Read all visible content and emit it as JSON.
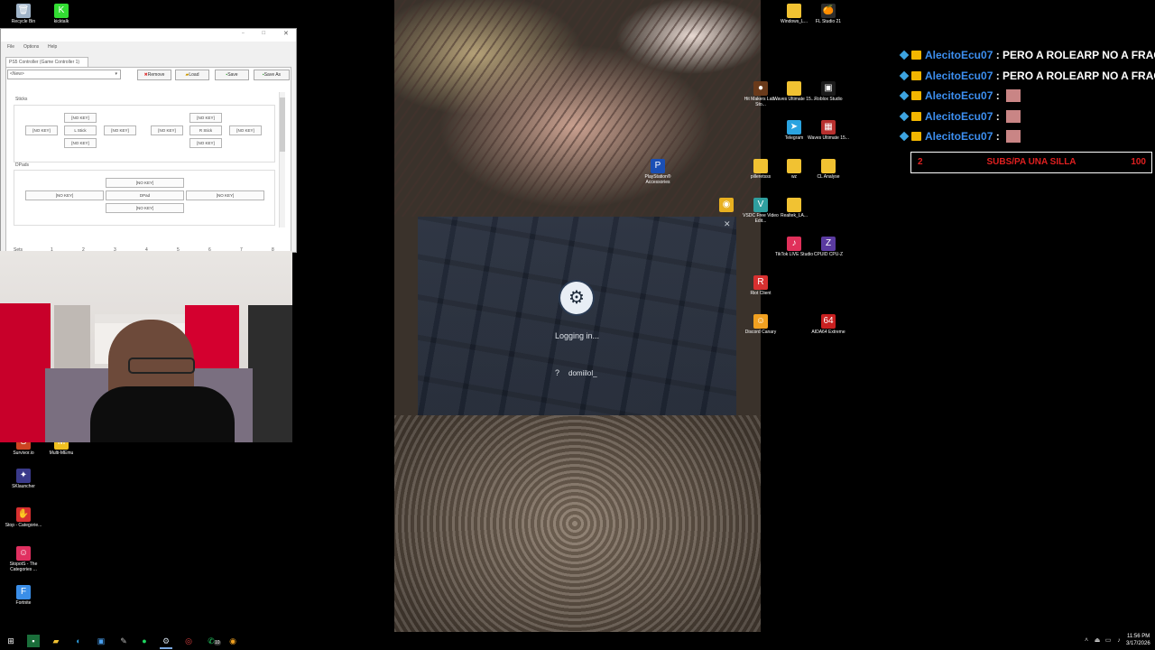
{
  "desktop_left": [
    {
      "name": "recycle-bin-icon",
      "label": "Recycle Bin",
      "color": "#9fb3c8",
      "glyph": "🗑"
    },
    {
      "name": "kicktalk-icon",
      "label": "kicktalk",
      "color": "#33dd33",
      "glyph": "K"
    },
    {
      "name": "survivor-icon",
      "label": "Survivor.io",
      "color": "#cc4422",
      "glyph": "S"
    },
    {
      "name": "multi-memu-icon",
      "label": "Multi-MEmu",
      "color": "#f0c020",
      "glyph": "M"
    },
    {
      "name": "sklauncher-icon",
      "label": "SKlauncher",
      "color": "#3a3a8a",
      "glyph": "✦"
    },
    {
      "name": "stop-categories-icon",
      "label": "Stop - Categorie...",
      "color": "#d83030",
      "glyph": "✋"
    },
    {
      "name": "stopots-icon",
      "label": "StopotS - The Categories ...",
      "color": "#e03060",
      "glyph": "☺"
    },
    {
      "name": "fortnite-icon",
      "label": "Fortnite",
      "color": "#3a8ee8",
      "glyph": "F"
    }
  ],
  "desktop_right": [
    {
      "name": "windows-folder-icon",
      "label": "Windows_L...",
      "folder": true
    },
    {
      "name": "fl-studio-icon",
      "label": "FL Studio 21",
      "color": "#2d2d2d",
      "glyph": "🍊"
    },
    {
      "name": "hit-makers-icon",
      "label": "Hit Makers Lab - Sto...",
      "color": "#6a3a1a",
      "glyph": "●"
    },
    {
      "name": "waves-folder-icon",
      "label": "Waves Ultimate 15...",
      "folder": true
    },
    {
      "name": "roblox-studio-icon",
      "label": "Roblox Studio",
      "color": "#1a1a1a",
      "glyph": "▣"
    },
    {
      "name": "telegram-icon",
      "label": "Telegram",
      "color": "#2aa3e0",
      "glyph": "➤"
    },
    {
      "name": "waves-ultimate-icon",
      "label": "Waves Ultimate 15...",
      "color": "#b8302e",
      "glyph": "▦"
    },
    {
      "name": "playstation-accessories-icon",
      "label": "PlayStation® Accessories",
      "color": "#1a4fb5",
      "glyph": "P"
    },
    {
      "name": "pilleretsss-folder-icon",
      "label": "pilleretsss",
      "folder": true
    },
    {
      "name": "wz-folder-icon",
      "label": "wz",
      "folder": true
    },
    {
      "name": "cl-analyse-folder-icon",
      "label": "CL Analyse",
      "folder": true
    },
    {
      "name": "chrome-icon",
      "label": "",
      "color": "#e8b020",
      "glyph": "◉"
    },
    {
      "name": "vsdc-icon",
      "label": "VSDC Free Video Edit...",
      "color": "#2f9f9f",
      "glyph": "V"
    },
    {
      "name": "realtek-folder-icon",
      "label": "Realtek_LA...",
      "folder": true
    },
    {
      "name": "tiktok-live-icon",
      "label": "TikTok LIVE Studio",
      "color": "#e0305a",
      "glyph": "♪"
    },
    {
      "name": "cpuid-icon",
      "label": "CPUID CPU-Z",
      "color": "#5a3aa0",
      "glyph": "Z"
    },
    {
      "name": "riot-client-icon",
      "label": "Riot Client",
      "color": "#d83030",
      "glyph": "R"
    },
    {
      "name": "discord-canary-icon",
      "label": "Discord Canary",
      "color": "#f0a020",
      "glyph": "☺"
    },
    {
      "name": "aida64-icon",
      "label": "AIDA64 Extreme",
      "color": "#c82020",
      "glyph": "64"
    }
  ],
  "pad_window": {
    "title": "",
    "menu": [
      "File",
      "Options",
      "Help"
    ],
    "profile_tab": "PS5 Controller (Game Controller 1)",
    "profile_select": "<New>",
    "buttons": [
      "Remove",
      "Load",
      "Save",
      "Save As"
    ],
    "sticks_label": "Sticks",
    "dpads_label": "DPads",
    "no_key": "[NO KEY]",
    "lstick": "L Stick",
    "rstick": "R Stick",
    "dpad": "DPad",
    "sets_label": "Sets",
    "sets": [
      "1",
      "2",
      "3",
      "4",
      "5",
      "6",
      "7",
      "8"
    ]
  },
  "steam": {
    "logging_text": "Logging in...",
    "user_icon": "?",
    "username": "domiilol_"
  },
  "chat": {
    "messages": [
      {
        "user": "AlecitoEcu07",
        "text": "PERO A ROLEARP NO A FRACAS",
        "emote": false
      },
      {
        "user": "AlecitoEcu07",
        "text": "PERO A ROLEARP NO A FRACAS",
        "emote": false
      },
      {
        "user": "AlecitoEcu07",
        "text": "",
        "emote": true
      },
      {
        "user": "AlecitoEcu07",
        "text": "",
        "emote": true
      },
      {
        "user": "AlecitoEcu07",
        "text": "",
        "emote": true
      }
    ],
    "sep": " : ",
    "goal": {
      "current": "2",
      "label": "SUBS/PA UNA SILLA",
      "target": "100",
      "color": "#e02020"
    }
  },
  "taskbar": {
    "time": "11:56 PM",
    "date": "3/17/2026",
    "whatsapp_badge": "10"
  }
}
